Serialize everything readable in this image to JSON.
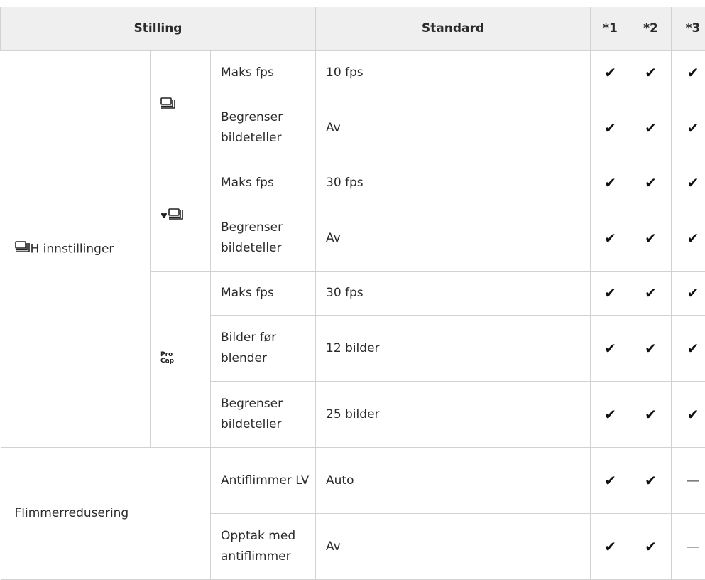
{
  "header": {
    "col_stilling": "Stilling",
    "col_standard": "Standard",
    "col_1": "*1",
    "col_2": "*2",
    "col_3": "*3"
  },
  "group1": {
    "label": "H innstillinger",
    "icon": "sequential-burst-icon",
    "sub1": {
      "icon": "sequential-burst-icon",
      "rows": [
        {
          "setting": "Maks fps",
          "standard": "10 fps"
        },
        {
          "setting": "Begrenser bildeteller",
          "standard": "Av"
        }
      ]
    },
    "sub2": {
      "icon": "silent-burst-heart-icon",
      "rows": [
        {
          "setting": "Maks fps",
          "standard": "30 fps"
        },
        {
          "setting": "Begrenser bildeteller",
          "standard": "Av"
        }
      ]
    },
    "sub3": {
      "icon": "pro-capture-icon",
      "icon_text_1": "Pro",
      "icon_text_2": "Cap",
      "rows": [
        {
          "setting": "Maks fps",
          "standard": "30 fps"
        },
        {
          "setting": "Bilder før blender",
          "standard": "12 bilder"
        },
        {
          "setting": "Begrenser bildeteller",
          "standard": "25 bilder"
        }
      ]
    }
  },
  "group2": {
    "label": "Flimmerredusering",
    "rows": [
      {
        "setting": "Antiflimmer LV",
        "standard": "Auto"
      },
      {
        "setting": "Opptak med antiflimmer",
        "standard": "Av"
      }
    ]
  },
  "marks": {
    "check": "✔",
    "dash": "—"
  }
}
